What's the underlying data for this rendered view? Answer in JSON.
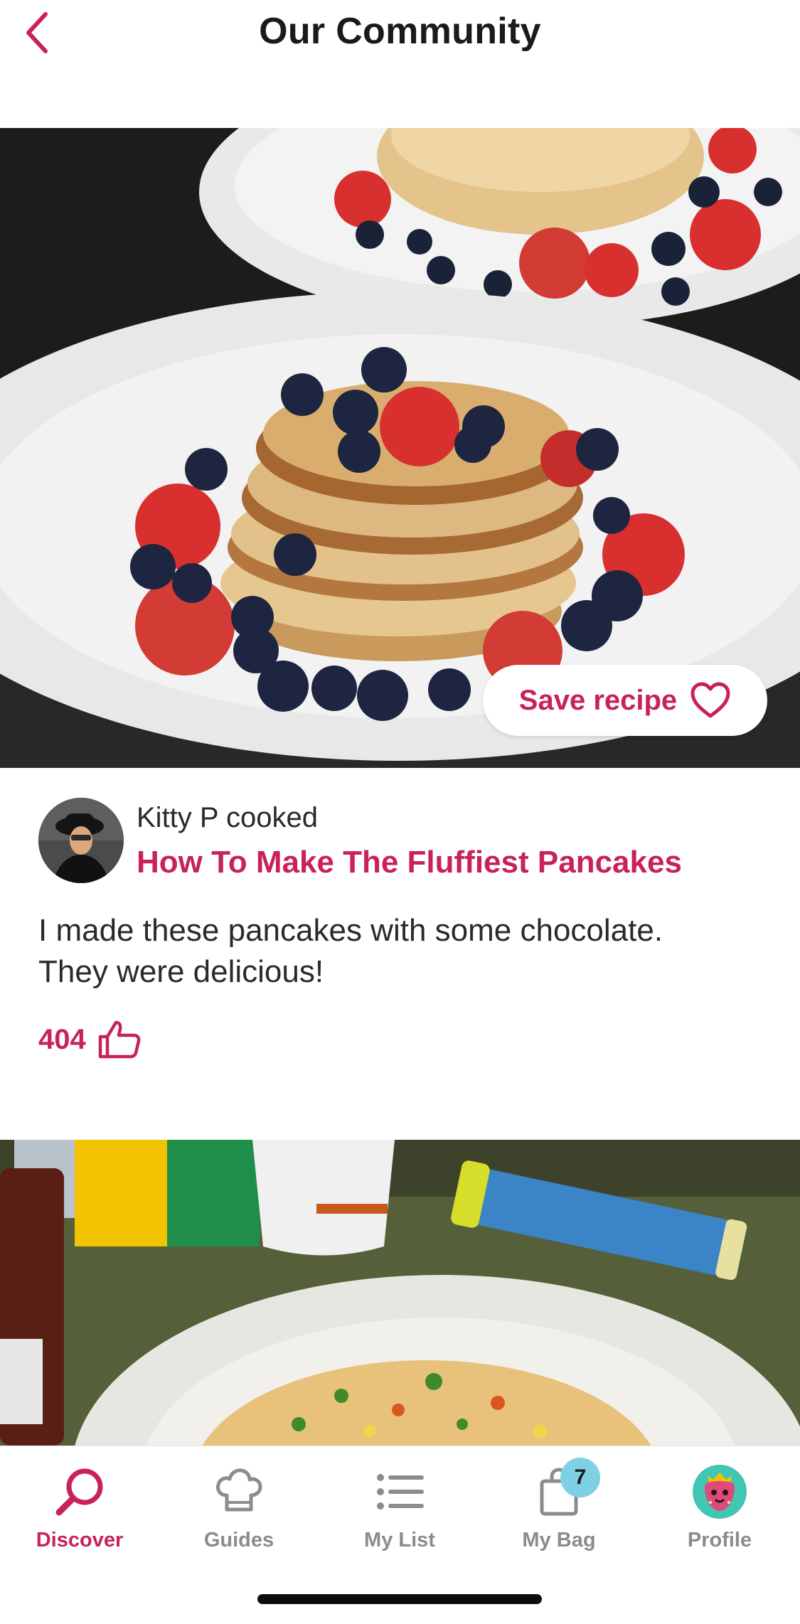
{
  "header": {
    "title": "Our Community",
    "back_icon": "chevron-left-icon"
  },
  "post": {
    "save_label": "Save recipe",
    "save_icon": "heart-outline-icon",
    "author_line": "Kitty P cooked",
    "recipe_title": "How To Make The Fluffiest Pancakes",
    "comment_line1": "I made these pancakes with some chocolate.",
    "comment_line2": "They were delicious!",
    "like_count": "404",
    "like_icon": "thumbs-up-icon"
  },
  "nav": {
    "items": [
      {
        "label": "Discover",
        "icon": "search-icon",
        "active": true
      },
      {
        "label": "Guides",
        "icon": "chef-hat-icon"
      },
      {
        "label": "My List",
        "icon": "list-icon"
      },
      {
        "label": "My Bag",
        "icon": "shopping-bag-icon",
        "badge": "7"
      },
      {
        "label": "Profile",
        "icon": "strawberry-avatar-icon"
      }
    ]
  },
  "colors": {
    "accent": "#c8215d",
    "badge": "#7fd0e4",
    "inactive": "#8c8c8c"
  }
}
